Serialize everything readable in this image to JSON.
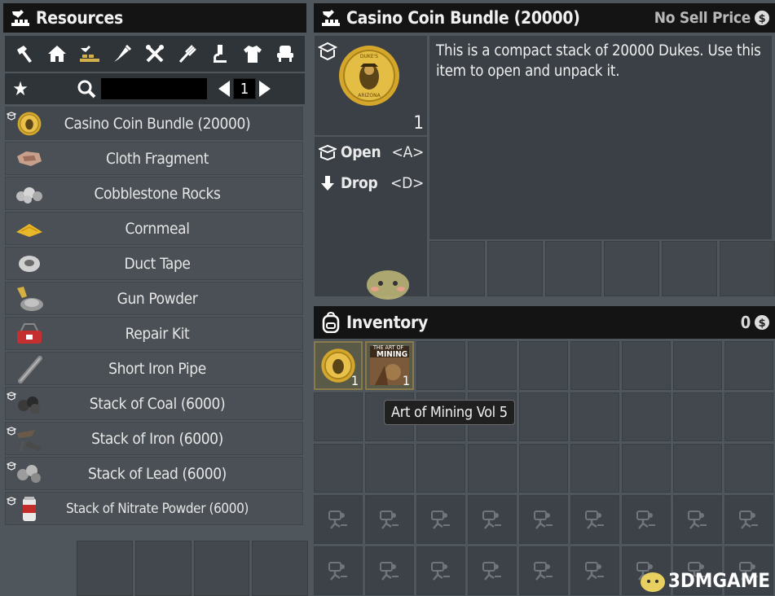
{
  "resources": {
    "title": "Resources",
    "categories": [
      "hammer-icon",
      "house-icon",
      "blocks-icon",
      "syringe-icon",
      "tools-icon",
      "fork-icon",
      "microscope-icon",
      "shirt-icon",
      "chair-icon"
    ],
    "search_placeholder": "",
    "page": "1",
    "items": [
      {
        "name": "Casino Coin Bundle (20000)",
        "icon": "coin",
        "badge": true,
        "selected": true
      },
      {
        "name": "Cloth Fragment",
        "icon": "cloth",
        "badge": false
      },
      {
        "name": "Cobblestone Rocks",
        "icon": "rocks",
        "badge": false
      },
      {
        "name": "Cornmeal",
        "icon": "cornmeal",
        "badge": false
      },
      {
        "name": "Duct Tape",
        "icon": "tape",
        "badge": false
      },
      {
        "name": "Gun Powder",
        "icon": "powder",
        "badge": false
      },
      {
        "name": "Repair Kit",
        "icon": "kit",
        "badge": false
      },
      {
        "name": "Short Iron Pipe",
        "icon": "pipe",
        "badge": false
      },
      {
        "name": "Stack of Coal (6000)",
        "icon": "coal",
        "badge": true
      },
      {
        "name": "Stack of Iron (6000)",
        "icon": "iron",
        "badge": true
      },
      {
        "name": "Stack of Lead (6000)",
        "icon": "lead",
        "badge": true
      },
      {
        "name": "Stack of Nitrate Powder (6000)",
        "icon": "nitrate",
        "badge": true,
        "small": true
      }
    ]
  },
  "detail": {
    "title": "Casino Coin Bundle (20000)",
    "sell_note": "No Sell Price",
    "quantity": "1",
    "description": "This is a compact stack of 20000 Dukes. Use this item to open and unpack it.",
    "actions": [
      {
        "label": "Open",
        "key": "<A>",
        "icon": "open-box-icon"
      },
      {
        "label": "Drop",
        "key": "<D>",
        "icon": "drop-arrow-icon"
      }
    ]
  },
  "inventory": {
    "title": "Inventory",
    "money": "0",
    "slot_counts": [
      "1",
      "1"
    ],
    "tooltip": "Art of Mining Vol 5",
    "book_title_top": "THE ART OF",
    "book_title_main": "MINING"
  },
  "coin_text": {
    "top": "DUKE'S",
    "mid": "CASINO",
    "bottom": "ARIZONA"
  },
  "watermark": "3DMGAME",
  "colors": {
    "header_bg": "#141414",
    "panel_bg": "#4f565c",
    "row_bg": "#4a5055",
    "gold": "#d4a72c"
  }
}
